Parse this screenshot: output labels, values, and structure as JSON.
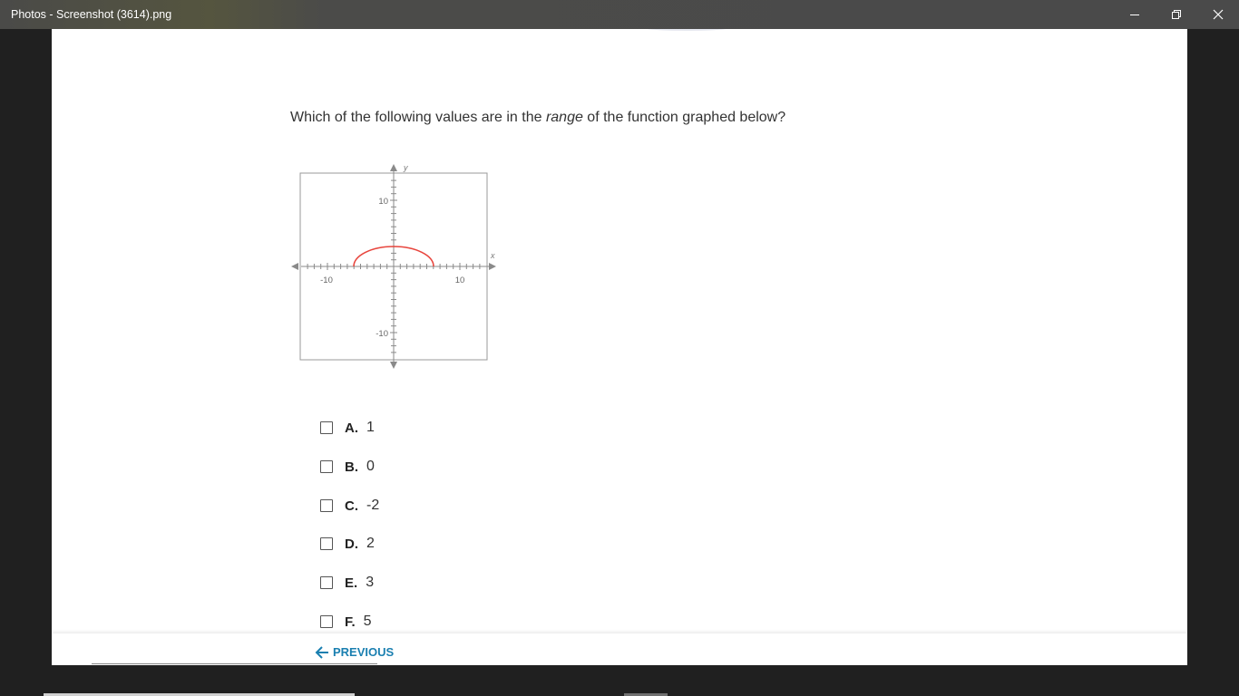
{
  "window": {
    "title": "Photos - Screenshot (3614).png"
  },
  "question": {
    "prefix": "Which of the following values are in the ",
    "emphasis": "range",
    "suffix": " of the function graphed below?"
  },
  "graph": {
    "y_axis_label": "y",
    "x_axis_label": "x",
    "tick_labels": {
      "x_neg": "-10",
      "x_pos": "10",
      "y_pos": "10",
      "y_neg": "-10"
    },
    "curve_color": "#e8463e"
  },
  "options": [
    {
      "letter": "A.",
      "value": "1"
    },
    {
      "letter": "B.",
      "value": "0"
    },
    {
      "letter": "C.",
      "value": "-2"
    },
    {
      "letter": "D.",
      "value": "2"
    },
    {
      "letter": "E.",
      "value": "3"
    },
    {
      "letter": "F.",
      "value": "5"
    }
  ],
  "footer": {
    "previous_label": "PREVIOUS"
  },
  "colors": {
    "accent": "#1a7fb0",
    "curve": "#e8463e"
  }
}
